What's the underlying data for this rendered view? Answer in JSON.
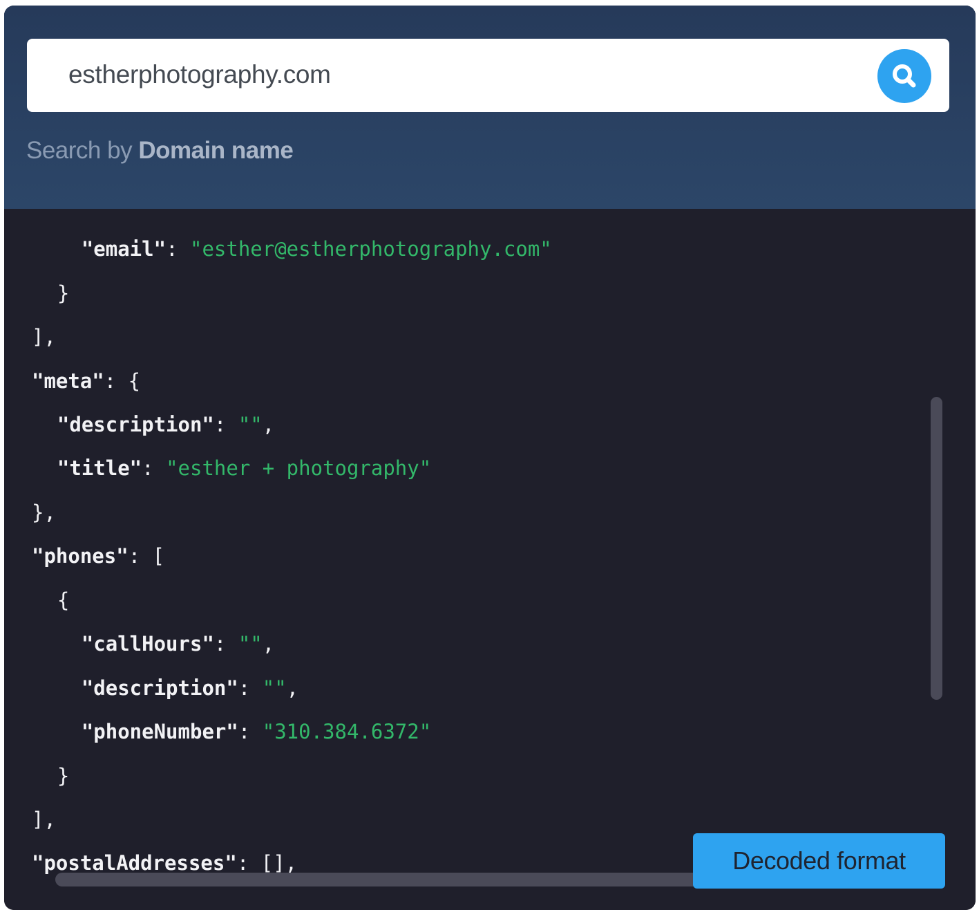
{
  "search": {
    "value": "estherphotography.com",
    "hint_prefix": "Search by ",
    "hint_bold": "Domain name",
    "button_icon": "search-icon"
  },
  "code_lines": [
    {
      "t": [
        "    ",
        "\"email\"",
        ": ",
        "\"esther@estherphotography.com\""
      ]
    },
    {
      "t": [
        "  }"
      ]
    },
    {
      "t": [
        "],"
      ]
    },
    {
      "t": [
        "\"meta\"",
        ": {"
      ]
    },
    {
      "t": [
        "  ",
        "\"description\"",
        ": ",
        "\"\"",
        ","
      ]
    },
    {
      "t": [
        "  ",
        "\"title\"",
        ": ",
        "\"esther + photography\""
      ]
    },
    {
      "t": [
        "},"
      ]
    },
    {
      "t": [
        "\"phones\"",
        ": ["
      ]
    },
    {
      "t": [
        "  {"
      ]
    },
    {
      "t": [
        "    ",
        "\"callHours\"",
        ": ",
        "\"\"",
        ","
      ]
    },
    {
      "t": [
        "    ",
        "\"description\"",
        ": ",
        "\"\"",
        ","
      ]
    },
    {
      "t": [
        "    ",
        "\"phoneNumber\"",
        ": ",
        "\"310.384.6372\""
      ]
    },
    {
      "t": [
        "  }"
      ]
    },
    {
      "t": [
        "],"
      ]
    },
    {
      "t": [
        "\"postalAddresses\"",
        ": [],"
      ]
    }
  ],
  "code_classes": [
    [
      "p",
      "k",
      "p",
      "s"
    ],
    [
      "p"
    ],
    [
      "p"
    ],
    [
      "k",
      "p"
    ],
    [
      "p",
      "k",
      "p",
      "s",
      "p"
    ],
    [
      "p",
      "k",
      "p",
      "s"
    ],
    [
      "p"
    ],
    [
      "k",
      "p"
    ],
    [
      "p"
    ],
    [
      "p",
      "k",
      "p",
      "s",
      "p"
    ],
    [
      "p",
      "k",
      "p",
      "s",
      "p"
    ],
    [
      "p",
      "k",
      "p",
      "s"
    ],
    [
      "p"
    ],
    [
      "p"
    ],
    [
      "k",
      "p"
    ]
  ],
  "decoded_button": "Decoded format",
  "colors": {
    "header": "#263a5a",
    "code_bg": "#1f1f2b",
    "string": "#33b86a",
    "accent": "#2ea3f0"
  }
}
